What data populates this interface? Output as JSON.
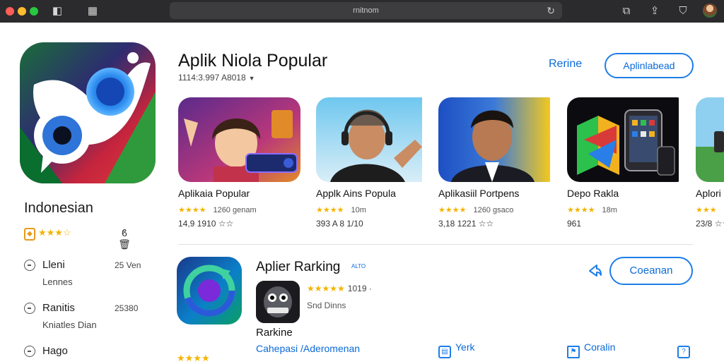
{
  "window": {
    "address": "rnitnom",
    "icons": [
      "sidebar-toggle-icon",
      "tab-overview-icon",
      "reload-icon",
      "reader-icon",
      "share-icon",
      "shield-icon",
      "profile-avatar"
    ]
  },
  "sidebar": {
    "region_title": "Indonesian",
    "rating_stars": "★★★☆",
    "items": [
      {
        "label": "Lleni",
        "count": "25 Ven",
        "sub": "Lennes"
      },
      {
        "label": "Ranitis",
        "count": "25380",
        "sub": "Kniatles Dian"
      },
      {
        "label": "Hago",
        "count": "",
        "sub": ""
      }
    ]
  },
  "header": {
    "title": "Aplik  Niola Popular",
    "meta": "1114:3.997 A8018",
    "link_label": "Rerine",
    "button_label": "Aplinlabead"
  },
  "cards": [
    {
      "title": "Aplikaia Popular",
      "stars": "★★★★",
      "count": "1260 genam",
      "dev": "14,9 1910 ☆☆"
    },
    {
      "title": "Applk Ains Popula",
      "stars": "★★★★",
      "count": "10m",
      "dev": "393 A 8 1/10"
    },
    {
      "title": "Aplikasiil Portpens",
      "stars": "★★★★",
      "count": "1260 gsaco",
      "dev": "3,18 1221 ☆☆"
    },
    {
      "title": "Depo Rakla",
      "stars": "★★★★",
      "count": "18m",
      "dev": "961"
    },
    {
      "title": "Aplori",
      "stars": "★★★",
      "count": "",
      "dev": "23/8 ☆☆"
    }
  ],
  "featured": {
    "title": "Aplier Rarking",
    "tag": "ALTO",
    "stars": "★★★★★",
    "count": "1019 ·",
    "sub": "Snd Dinns",
    "label": "Rarkine",
    "link": "Cahepasi /Aderomenan",
    "button_label": "Coeanan"
  },
  "bottom_actions": [
    {
      "label": "Yerk",
      "icon": "bookmark-icon"
    },
    {
      "label": "Coralin",
      "icon": "flag-icon"
    },
    {
      "label": "",
      "icon": "question-icon"
    }
  ],
  "bottom_stars": "★★★★",
  "colors": {
    "accent": "#0a6ad8",
    "star": "#f4b400",
    "chrome": "#2b2b2d"
  }
}
